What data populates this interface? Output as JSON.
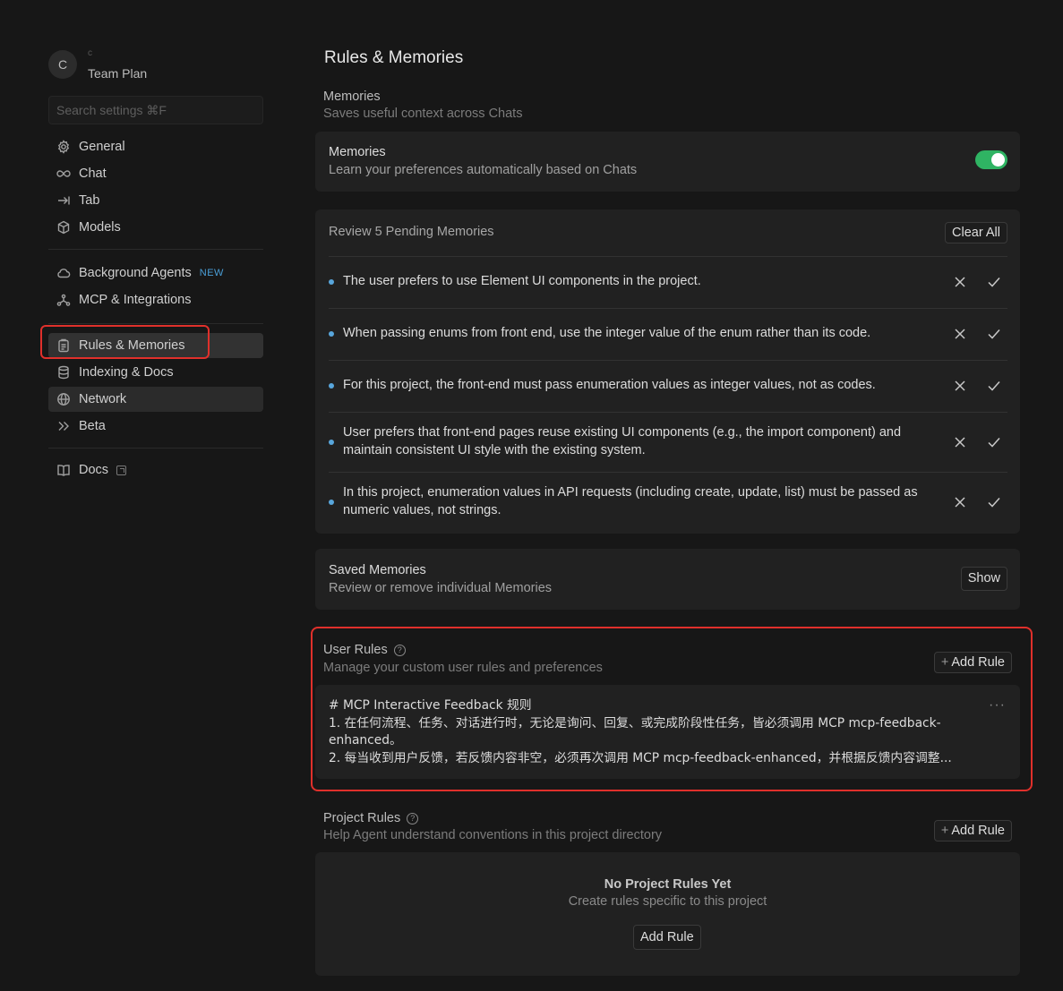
{
  "sidebar": {
    "avatar_letter": "C",
    "account_name": "c",
    "plan": "Team Plan",
    "search_placeholder": "Search settings ⌘F",
    "groups": [
      [
        {
          "label": "General",
          "icon": "gear-icon"
        },
        {
          "label": "Chat",
          "icon": "infinity-icon"
        },
        {
          "label": "Tab",
          "icon": "tab-arrow-icon"
        },
        {
          "label": "Models",
          "icon": "cube-icon"
        }
      ],
      [
        {
          "label": "Background Agents",
          "icon": "cloud-icon",
          "badge": "NEW"
        },
        {
          "label": "MCP & Integrations",
          "icon": "nodes-icon"
        }
      ],
      [
        {
          "label": "Rules & Memories",
          "icon": "clipboard-icon"
        },
        {
          "label": "Indexing & Docs",
          "icon": "database-icon"
        },
        {
          "label": "Network",
          "icon": "globe-icon"
        },
        {
          "label": "Beta",
          "icon": "double-chevron-icon"
        }
      ],
      [
        {
          "label": "Docs",
          "icon": "book-icon"
        }
      ]
    ]
  },
  "main": {
    "title": "Rules & Memories",
    "memories_section": {
      "label": "Memories",
      "sub": "Saves useful context across Chats"
    },
    "memories_card": {
      "title": "Memories",
      "sub": "Learn your preferences automatically based on Chats",
      "enabled": true
    },
    "pending": {
      "header": "Review 5 Pending Memories",
      "clear_all": "Clear All",
      "items": [
        "The user prefers to use Element UI components in the project.",
        "When passing enums from front end, use the integer value of the enum rather than its code.",
        "For this project, the front-end must pass enumeration values as integer values, not as codes.",
        "User prefers that front-end pages reuse existing UI components (e.g., the import component) and maintain consistent UI style with the existing system.",
        "In this project, enumeration values in API requests (including create, update, list) must be passed as numeric values, not strings."
      ]
    },
    "saved": {
      "title": "Saved Memories",
      "sub": "Review or remove individual Memories",
      "button": "Show"
    },
    "user_rules": {
      "label": "User Rules",
      "help": "?",
      "sub": "Manage your custom user rules and preferences",
      "add_button": "Add Rule",
      "rule_lines": [
        "# MCP Interactive Feedback 规则",
        "1. 在任何流程、任务、对话进行时，无论是询问、回复、或完成阶段性任务，皆必须调用 MCP mcp-feedback-enhanced。",
        "2. 每当收到用户反馈，若反馈内容非空，必须再次调用 MCP mcp-feedback-enhanced，并根据反馈内容调整..."
      ],
      "menu": "···"
    },
    "project_rules": {
      "label": "Project Rules",
      "help": "?",
      "sub": "Help Agent understand conventions in this project directory",
      "add_button": "Add Rule",
      "empty_title": "No Project Rules Yet",
      "empty_sub": "Create rules specific to this project",
      "empty_button": "Add Rule"
    }
  },
  "colors": {
    "background": "#171717",
    "card": "#212121",
    "toggle_on": "#2fb463",
    "highlight": "#e0302b",
    "bullet": "#58a6dc",
    "badge_new": "#4a9fd8"
  }
}
